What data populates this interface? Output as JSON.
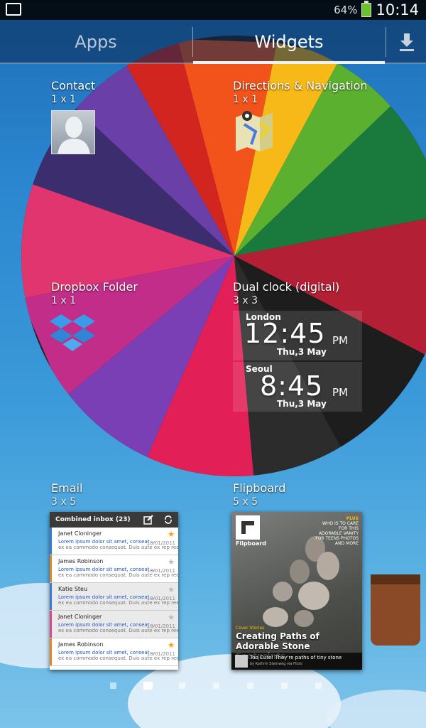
{
  "status_bar": {
    "battery_percent": "64%",
    "time": "10:14",
    "battery_level": 0.64
  },
  "tabs": {
    "apps": "Apps",
    "widgets": "Widgets",
    "active": "Widgets"
  },
  "widgets": [
    {
      "title": "Contact",
      "size": "1 x 1",
      "icon": "contact-silhouette-icon"
    },
    {
      "title": "Directions & Navigation",
      "size": "1 x 1",
      "icon": "map-navigation-icon"
    },
    {
      "title": "Dropbox Folder",
      "size": "1 x 1",
      "icon": "dropbox-icon"
    },
    {
      "title": "Dual clock (digital)",
      "size": "3 x 3"
    },
    {
      "title": "Email",
      "size": "3 x 5"
    },
    {
      "title": "Flipboard",
      "size": "5 x 5"
    }
  ],
  "dual_clock": {
    "city1": "London",
    "time1": "12:45",
    "ampm1": "PM",
    "date1": "Thu,3 May",
    "city2": "Seoul",
    "time2": "8:45",
    "ampm2": "PM",
    "date2": "Thu,3 May"
  },
  "email_widget": {
    "header": "Combined inbox (23)",
    "rows": [
      {
        "name": "Janet Cloninger",
        "line1": "Lorem ipsum dolor sit amet, conseat ...",
        "line2": "ex ea commodo consequat. Duis aute ex rep reehe",
        "date": "18/01/2011",
        "starred": true,
        "read": false,
        "bar_color": "#3a7bd5"
      },
      {
        "name": "James Robinson",
        "line1": "Lorem ipsum dolor sit amet, conseat ...",
        "line2": "ex ea commodo consequat. Duis aute ex rep reehe",
        "date": "18/01/2011",
        "starred": false,
        "read": false,
        "bar_color": "#e0892a"
      },
      {
        "name": "Katie Steu",
        "line1": "Lorem ipsum dolor sit amet, conseat ...",
        "line2": "ex ea commodo consequat. Duis aute ex rep reehe",
        "date": "18/01/2011",
        "starred": false,
        "read": true,
        "bar_color": "#3a7bd5"
      },
      {
        "name": "Janet Cloninger",
        "line1": "Lorem ipsum dolor sit amet, conseat ...",
        "line2": "ex ea commodo consequat. Duis aute ex rep reehe",
        "date": "18/01/2011",
        "starred": false,
        "read": true,
        "bar_color": "#d94a8c"
      },
      {
        "name": "James Robinson",
        "line1": "Lorem ipsum dolor sit amet, conseat ...",
        "line2": "ex ea commodo consequat. Duis aute ex rep reehe",
        "date": "18/01/2011",
        "starred": true,
        "read": false,
        "bar_color": "#e0892a"
      }
    ]
  },
  "flipboard_widget": {
    "name": "Flipboard",
    "side_tag": "PLUS",
    "side_text": "WHO IS TO CARE FOR THIS ADORABLE VANITY FOR TEENS PHOTOS AND MORE",
    "category": "Cover Stories",
    "headline": "Creating Paths of Adorable Stone Footprints",
    "caption": "Too Cute! They're paths of tiny stone",
    "byline": "by Kathrin Steinweg via Flickr"
  },
  "pager": {
    "pages": 7,
    "active_index": 1
  },
  "colors": {
    "accent": "#e9eef3",
    "star_active": "#f6a000",
    "star_inactive": "#bbbbbb"
  }
}
